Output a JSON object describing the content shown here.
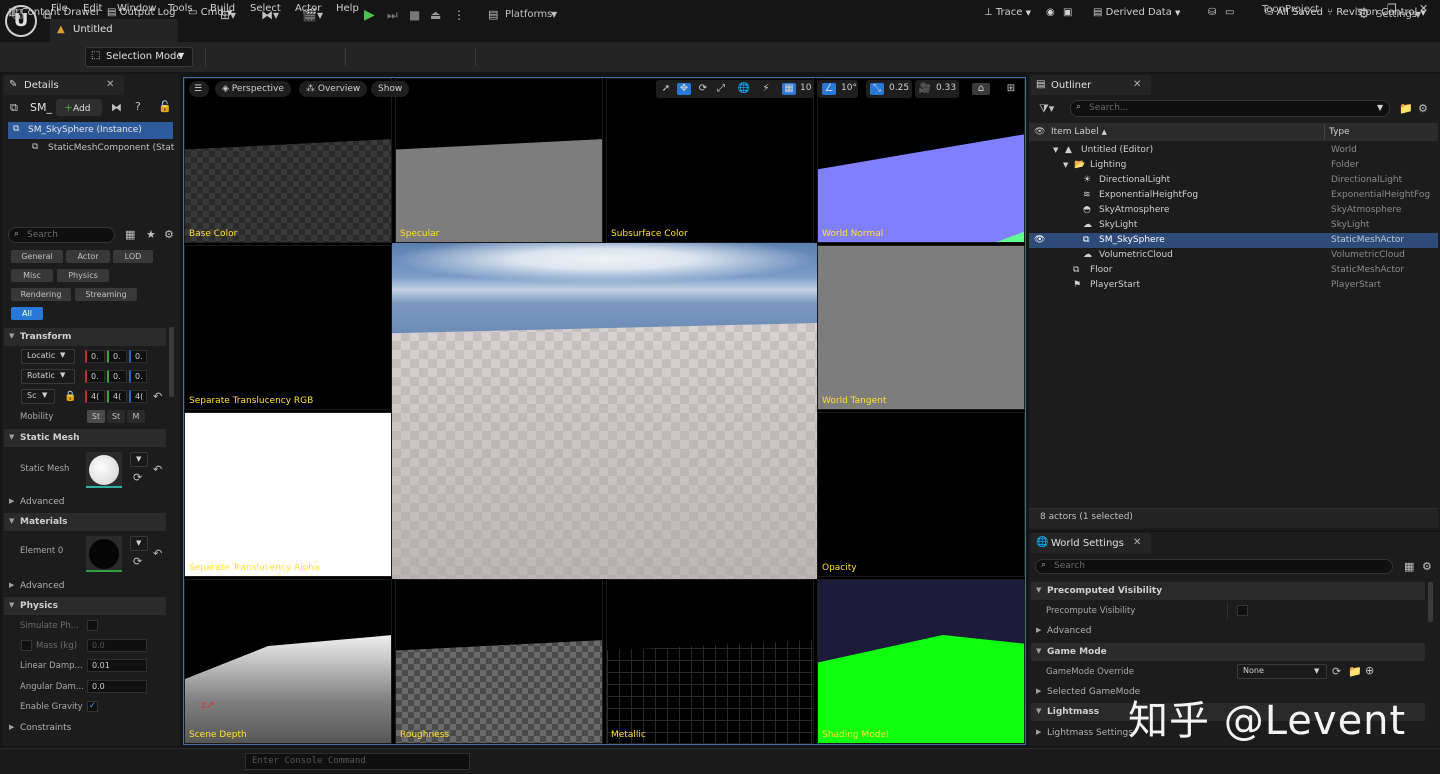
{
  "menu": [
    "File",
    "Edit",
    "Window",
    "Tools",
    "Build",
    "Select",
    "Actor",
    "Help"
  ],
  "doc_tab": "Untitled",
  "project_name": "ToonProject",
  "toolbar": {
    "selection_mode": "Selection Mode",
    "platforms": "Platforms",
    "settings": "Settings"
  },
  "details": {
    "tab_label": "Details",
    "actor_short": "SM_",
    "add_label": "Add",
    "tree": [
      "SM_SkySphere (Instance)",
      "StaticMeshComponent (Static"
    ],
    "search_placeholder": "Search",
    "categories": [
      "General",
      "Actor",
      "LOD",
      "Misc",
      "Physics",
      "Rendering",
      "Streaming",
      "All"
    ],
    "transform": {
      "header": "Transform",
      "location": "Locatic",
      "rotation": "Rotatic",
      "scale": "Sc",
      "loc_values": [
        "0.",
        "0.",
        "0."
      ],
      "rot_values": [
        "0.",
        "0.",
        "0."
      ],
      "scale_values": [
        "4(",
        "4(",
        "4("
      ],
      "mobility": "Mobility",
      "mobility_opts": [
        "St",
        "St",
        "M"
      ]
    },
    "static_mesh": {
      "header": "Static Mesh",
      "label": "Static Mesh",
      "advanced": "Advanced"
    },
    "materials": {
      "header": "Materials",
      "label": "Element 0",
      "advanced": "Advanced"
    },
    "physics": {
      "header": "Physics",
      "simulate": "Simulate Ph...",
      "mass": "Mass (kg)",
      "mass_val": "0.0",
      "linear": "Linear Damp...",
      "linear_val": "0.01",
      "angular": "Angular Dam...",
      "angular_val": "0.0",
      "gravity": "Enable Gravity"
    },
    "constraints": "Constraints"
  },
  "viewport": {
    "perspective": "Perspective",
    "overview": "Overview",
    "show": "Show",
    "grid_val": "10",
    "angle_val": "10°",
    "scale_val": "0.25",
    "cam_val": "0.33",
    "cells": {
      "base_color": "Base Color",
      "specular": "Specular",
      "subsurface": "Subsurface Color",
      "world_normal": "World Normal",
      "sep_rgb": "Separate Translucency RGB",
      "world_tangent": "World Tangent",
      "sep_alpha": "Separate Translucency Alpha",
      "opacity": "Opacity",
      "scene_depth": "Scene Depth",
      "roughness": "Roughness",
      "metallic": "Metallic",
      "shading_model": "Shading Model"
    }
  },
  "outliner": {
    "tab_label": "Outliner",
    "search_placeholder": "Search...",
    "col_label": "Item Label",
    "col_type": "Type",
    "rows": [
      {
        "label": "Untitled (Editor)",
        "type": "World"
      },
      {
        "label": "Lighting",
        "type": "Folder"
      },
      {
        "label": "DirectionalLight",
        "type": "DirectionalLight"
      },
      {
        "label": "ExponentialHeightFog",
        "type": "ExponentialHeightFog"
      },
      {
        "label": "SkyAtmosphere",
        "type": "SkyAtmosphere"
      },
      {
        "label": "SkyLight",
        "type": "SkyLight"
      },
      {
        "label": "SM_SkySphere",
        "type": "StaticMeshActor"
      },
      {
        "label": "VolumetricCloud",
        "type": "VolumetricCloud"
      },
      {
        "label": "Floor",
        "type": "StaticMeshActor"
      },
      {
        "label": "PlayerStart",
        "type": "PlayerStart"
      }
    ],
    "footer": "8 actors (1 selected)"
  },
  "world_settings": {
    "tab_label": "World Settings",
    "search_placeholder": "Search",
    "precomputed": "Precomputed Visibility",
    "precompute": "Precompute Visibility",
    "advanced": "Advanced",
    "game_mode": "Game Mode",
    "gamemode_override": "GameMode Override",
    "gamemode_val": "None",
    "selected_gamemode": "Selected GameMode",
    "lightmass": "Lightmass",
    "lightmass_settings": "Lightmass Settings"
  },
  "status": {
    "content_drawer": "Content Drawer",
    "output_log": "Output Log",
    "cmd": "Cmd",
    "console_placeholder": "Enter Console Command",
    "trace": "Trace",
    "derived": "Derived Data",
    "saved": "All Saved",
    "revision": "Revision Control"
  },
  "watermark": "知乎 @Levent"
}
